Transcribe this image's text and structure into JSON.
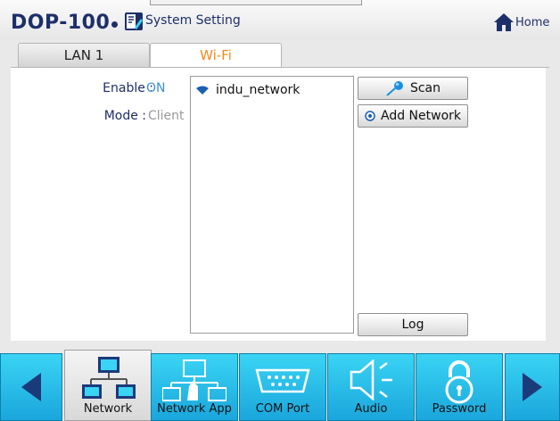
{
  "header": {
    "brand": "DOP-100",
    "title": "System Setting",
    "home_label": "Home"
  },
  "tabs": [
    {
      "label": "LAN 1",
      "active": false
    },
    {
      "label": "Wi-Fi",
      "active": true
    }
  ],
  "wifi": {
    "enable_label": "Enable :",
    "enable_value": "ON",
    "mode_label": "Mode :",
    "mode_value": "Client",
    "networks": [
      {
        "name": "indu_network",
        "icon": "wifi-signal-icon"
      }
    ],
    "scan_label": "Scan",
    "add_network_label": "Add Network",
    "log_label": "Log"
  },
  "nav": {
    "items": [
      {
        "label": "Network",
        "icon": "network-icon",
        "active": true
      },
      {
        "label": "Network App",
        "icon": "network-app-icon",
        "active": false
      },
      {
        "label": "COM Port",
        "icon": "com-port-icon",
        "active": false
      },
      {
        "label": "Audio",
        "icon": "speaker-icon",
        "active": false
      },
      {
        "label": "Password",
        "icon": "lock-icon",
        "active": false
      }
    ]
  },
  "colors": {
    "brand": "#1d2f6a",
    "accent_tab": "#f08a1c",
    "enable_value": "#3b8fd9",
    "nav_blue": "#1aa6dc"
  }
}
